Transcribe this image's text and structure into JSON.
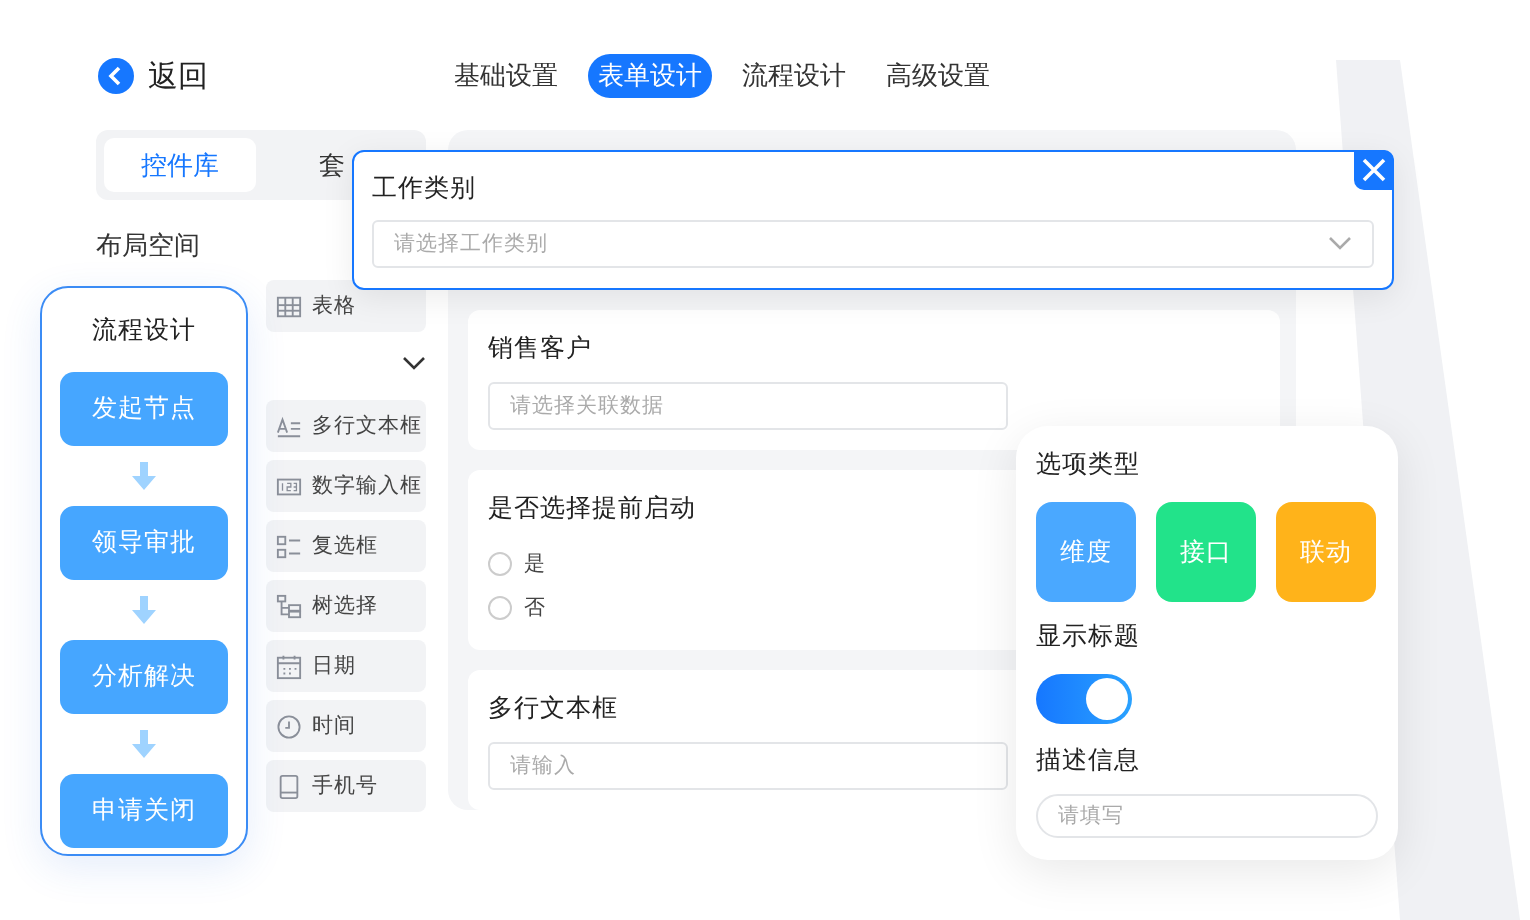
{
  "header": {
    "back": "返回"
  },
  "tabs": [
    {
      "label": "基础设置",
      "selected": false
    },
    {
      "label": "表单设计",
      "selected": true
    },
    {
      "label": "流程设计",
      "selected": false
    },
    {
      "label": "高级设置",
      "selected": false
    }
  ],
  "library": {
    "tabs": [
      {
        "label": "控件库",
        "selected": true
      },
      {
        "label": "套",
        "selected": false
      }
    ],
    "section": "布局空间",
    "layout_items": [
      {
        "kind": "table",
        "label": "表格"
      }
    ],
    "controls": [
      {
        "kind": "textarea",
        "label": "多行文本框"
      },
      {
        "kind": "number",
        "label": "数字输入框"
      },
      {
        "kind": "checkbox",
        "label": "复选框"
      },
      {
        "kind": "tree",
        "label": "树选择"
      },
      {
        "kind": "date",
        "label": "日期"
      },
      {
        "kind": "time",
        "label": "时间"
      },
      {
        "kind": "phone",
        "label": "手机号"
      }
    ]
  },
  "form": [
    {
      "kind": "input",
      "label": "销售客户",
      "placeholder": "请选择关联数据"
    },
    {
      "kind": "radio",
      "label": "是否选择提前启动",
      "options": [
        {
          "label": "是",
          "selected": false
        },
        {
          "label": "否",
          "selected": false
        }
      ]
    },
    {
      "kind": "input",
      "label": "多行文本框",
      "placeholder": "请输入"
    }
  ],
  "popup": {
    "label": "工作类别",
    "placeholder": "请选择工作类别"
  },
  "flow": {
    "title": "流程设计",
    "steps": [
      "发起节点",
      "领导审批",
      "分析解决",
      "申请关闭"
    ]
  },
  "options": {
    "title": "选项类型",
    "types": [
      {
        "label": "维度",
        "color": "#4aa8ff"
      },
      {
        "label": "接口",
        "color": "#22e38a"
      },
      {
        "label": "联动",
        "color": "#ffb31a"
      }
    ],
    "show_title": {
      "label": "显示标题",
      "on": true
    },
    "description": {
      "label": "描述信息",
      "placeholder": "请填写"
    }
  }
}
